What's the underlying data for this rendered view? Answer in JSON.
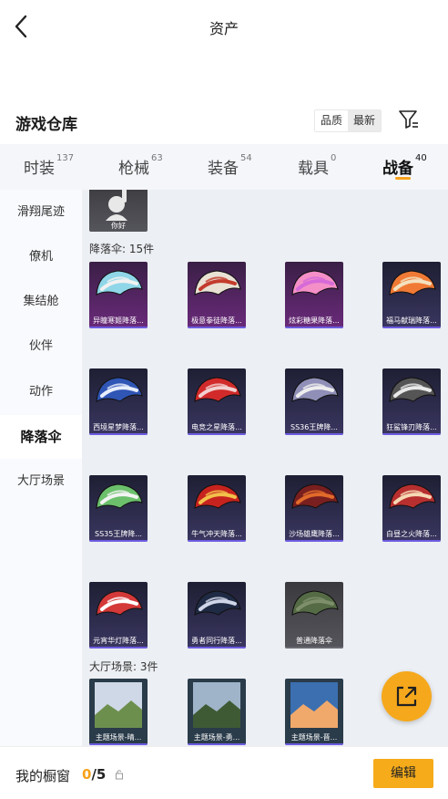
{
  "header": {
    "title": "资产"
  },
  "warehouse": {
    "title": "游戏仓库",
    "sort_options": [
      "品质",
      "最新"
    ],
    "sort_selected": "最新"
  },
  "tabs": [
    {
      "label": "时装",
      "count": "137",
      "active": false
    },
    {
      "label": "枪械",
      "count": "63",
      "active": false
    },
    {
      "label": "装备",
      "count": "54",
      "active": false
    },
    {
      "label": "载具",
      "count": "0",
      "active": false
    },
    {
      "label": "战备",
      "count": "40",
      "active": true
    }
  ],
  "sidebar": {
    "items": [
      {
        "label": "滑翔尾迹",
        "active": false
      },
      {
        "label": "僚机",
        "active": false
      },
      {
        "label": "集结舱",
        "active": false
      },
      {
        "label": "伙伴",
        "active": false
      },
      {
        "label": "动作",
        "active": false
      },
      {
        "label": "降落伞",
        "active": true
      },
      {
        "label": "大厅场景",
        "active": false
      }
    ]
  },
  "content": {
    "top_card": {
      "label": "你好"
    },
    "parachute_section": {
      "title": "降落伞: 15件",
      "items": [
        {
          "label": "异瞳寒姬降落...",
          "tier": "purple",
          "colors": [
            "#8fd6e8",
            "#f1f1f1"
          ]
        },
        {
          "label": "极意拳徒降落...",
          "tier": "purple",
          "colors": [
            "#e9e1d4",
            "#c33b2c"
          ]
        },
        {
          "label": "炫彩糖果降落...",
          "tier": "purple",
          "colors": [
            "#f58fc8",
            "#d56ad8"
          ]
        },
        {
          "label": "福马献瑞降落...",
          "tier": "blue",
          "colors": [
            "#f07a35",
            "#f4e1c0"
          ]
        },
        {
          "label": "西境星梦降落...",
          "tier": "blue",
          "colors": [
            "#2f55b5",
            "#e8eefc"
          ]
        },
        {
          "label": "电竞之星降落...",
          "tier": "blue",
          "colors": [
            "#d22a2a",
            "#f2d0d0"
          ]
        },
        {
          "label": "SS36王牌降...",
          "tier": "blue",
          "colors": [
            "#8f8fb8",
            "#eeeeee"
          ]
        },
        {
          "label": "狂鲨锋刃降落...",
          "tier": "blue",
          "colors": [
            "#555555",
            "#e9e9e9"
          ]
        },
        {
          "label": "SS35王牌降...",
          "tier": "blue",
          "colors": [
            "#6cc06c",
            "#f3f3f3"
          ]
        },
        {
          "label": "牛气冲天降落...",
          "tier": "blue",
          "colors": [
            "#c7231e",
            "#f2c14a"
          ]
        },
        {
          "label": "沙场雄鹰降落...",
          "tier": "blue",
          "colors": [
            "#7a1f1f",
            "#e26b2a"
          ]
        },
        {
          "label": "白昼之火降落...",
          "tier": "blue",
          "colors": [
            "#b82f2f",
            "#f5d9b5"
          ]
        },
        {
          "label": "元宵华灯降落...",
          "tier": "blue",
          "colors": [
            "#d43838",
            "#ffffff"
          ]
        },
        {
          "label": "勇者同行降落...",
          "tier": "blue",
          "colors": [
            "#1f2a44",
            "#cfd6e8"
          ]
        },
        {
          "label": "普通降落伞",
          "tier": "grey",
          "colors": [
            "#556b45",
            "#7d8f6b"
          ]
        }
      ]
    },
    "scene_section": {
      "title": "大厅场景: 3件",
      "items": [
        {
          "label": "主题场景-晴...",
          "colors": [
            "#cfd8e6",
            "#6d8f4e"
          ]
        },
        {
          "label": "主题场景-勇...",
          "colors": [
            "#9fb4c9",
            "#3e5a34"
          ]
        },
        {
          "label": "主题场景-晋...",
          "colors": [
            "#3b6fb0",
            "#f0a96b"
          ]
        }
      ]
    }
  },
  "bottom_bar": {
    "label": "我的橱窗",
    "current": "0",
    "separator": "/",
    "total": "5",
    "edit_label": "编辑"
  },
  "colors": {
    "accent": "#f6ab1a",
    "sidebar_bg": "#f9fafd",
    "content_bg": "#eceff3"
  }
}
